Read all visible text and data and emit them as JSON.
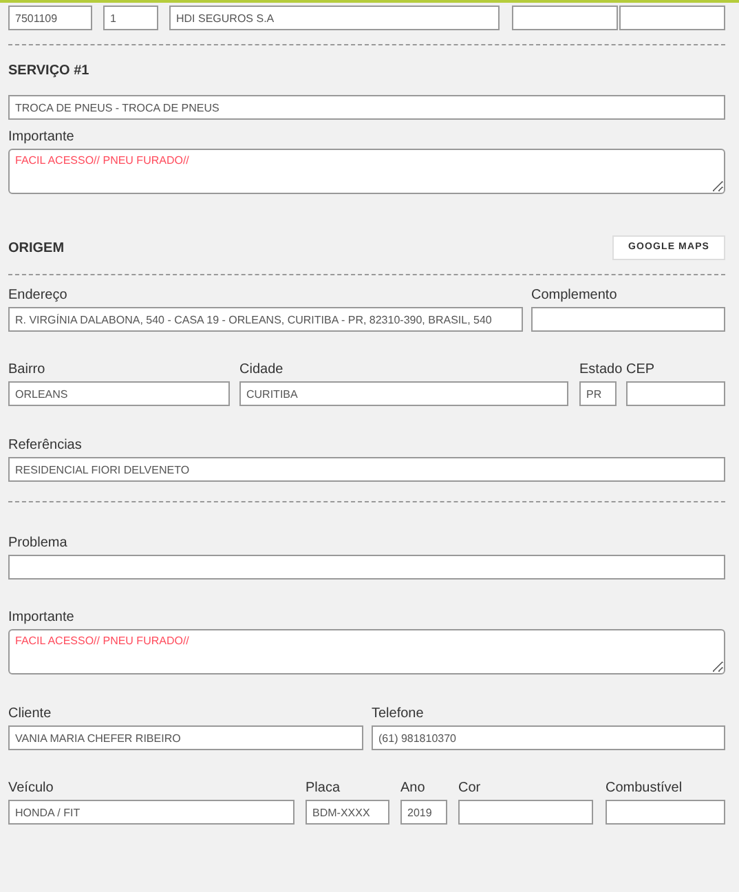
{
  "rows": [
    {
      "kind": "fields",
      "fields": [
        {
          "kind": "input",
          "value": "7501109"
        },
        {
          "kind": "input",
          "value": "1"
        },
        {
          "kind": "input",
          "value": "HDI SEGUROS S.A"
        },
        {
          "kind": "input"
        },
        {
          "kind": "input"
        }
      ]
    },
    {
      "kind": "divider"
    },
    {
      "kind": "heading",
      "text": "SERVIÇO #1"
    },
    {
      "kind": "fields",
      "fields": [
        {
          "kind": "input",
          "value": "TROCA DE PNEUS - TROCA DE PNEUS"
        }
      ]
    },
    {
      "kind": "fields",
      "fields": [
        {
          "kind": "textarea",
          "label": "Importante",
          "value": "FACIL ACESSO// PNEU FURADO//"
        }
      ]
    },
    {
      "kind": "heading",
      "text": "ORIGEM",
      "button": "GOOGLE MAPS"
    },
    {
      "kind": "divider"
    },
    {
      "kind": "fields",
      "fields": [
        {
          "kind": "input",
          "label": "Endereço",
          "value": "R. VIRGÍNIA DALABONA, 540 - CASA 19 - ORLEANS, CURITIBA - PR, 82310-390, BRASIL, 540"
        },
        {
          "kind": "input",
          "label": "Complemento"
        }
      ]
    },
    {
      "kind": "fields",
      "fields": [
        {
          "kind": "input",
          "label": "Bairro",
          "value": "ORLEANS"
        },
        {
          "kind": "input",
          "label": "Cidade",
          "value": "CURITIBA"
        },
        {
          "kind": "input",
          "label": "Estado",
          "value": "PR"
        },
        {
          "kind": "input",
          "label": "CEP"
        }
      ]
    },
    {
      "kind": "fields",
      "fields": [
        {
          "kind": "input",
          "label": "Referências",
          "value": "RESIDENCIAL FIORI DELVENETO"
        }
      ]
    },
    {
      "kind": "divider"
    },
    {
      "kind": "fields",
      "fields": [
        {
          "kind": "input",
          "label": "Problema"
        }
      ]
    },
    {
      "kind": "fields",
      "fields": [
        {
          "kind": "textarea",
          "label": "Importante",
          "value": "FACIL ACESSO// PNEU FURADO//"
        }
      ]
    },
    {
      "kind": "fields",
      "fields": [
        {
          "kind": "input",
          "label": "Cliente",
          "value": "VANIA MARIA CHEFER RIBEIRO"
        },
        {
          "kind": "input",
          "label": "Telefone",
          "value": "(61) 981810370"
        }
      ]
    },
    {
      "kind": "fields",
      "fields": [
        {
          "kind": "input",
          "label": "Veículo",
          "value": "HONDA / FIT"
        },
        {
          "kind": "input",
          "label": "Placa",
          "value": "BDM-XXXX"
        },
        {
          "kind": "input",
          "label": "Ano",
          "value": "2019"
        },
        {
          "kind": "input",
          "label": "Cor"
        },
        {
          "kind": "input",
          "label": "Combustível"
        }
      ]
    }
  ]
}
